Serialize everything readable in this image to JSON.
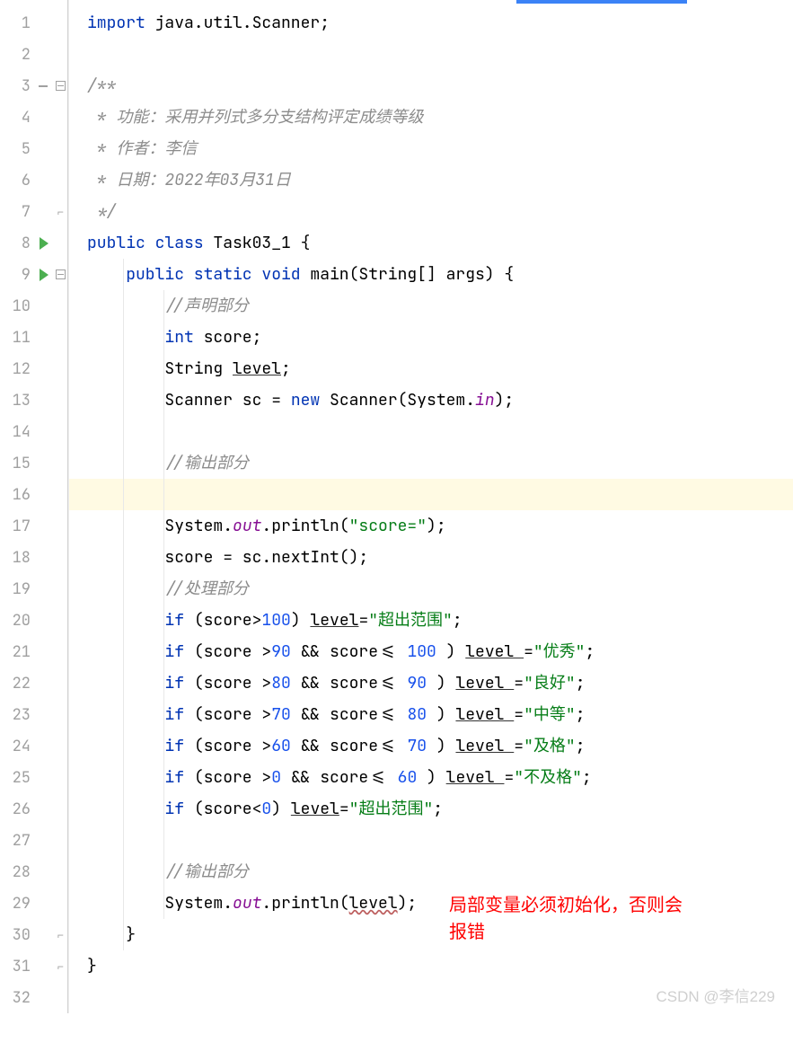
{
  "lines": [
    {
      "n": 1,
      "run": false,
      "fold": "",
      "indent": 0,
      "segments": [
        {
          "t": "import ",
          "c": "kw"
        },
        {
          "t": "java.util.Scanner;",
          "c": ""
        }
      ]
    },
    {
      "n": 2,
      "run": false,
      "fold": "",
      "indent": 0,
      "segments": []
    },
    {
      "n": 3,
      "run": false,
      "fold": "minus",
      "indent": 0,
      "segments": [
        {
          "t": "/**",
          "c": "comment"
        }
      ],
      "expand": true
    },
    {
      "n": 4,
      "run": false,
      "fold": "",
      "indent": 0,
      "segments": [
        {
          "t": " * 功能：采用并列式多分支结构评定成绩等级",
          "c": "comment"
        }
      ]
    },
    {
      "n": 5,
      "run": false,
      "fold": "",
      "indent": 0,
      "segments": [
        {
          "t": " * 作者：李信",
          "c": "comment"
        }
      ]
    },
    {
      "n": 6,
      "run": false,
      "fold": "",
      "indent": 0,
      "segments": [
        {
          "t": " * 日期：2022年03月31日",
          "c": "comment"
        }
      ]
    },
    {
      "n": 7,
      "run": false,
      "fold": "close",
      "indent": 0,
      "segments": [
        {
          "t": " */",
          "c": "comment"
        }
      ]
    },
    {
      "n": 8,
      "run": true,
      "fold": "",
      "indent": 0,
      "segments": [
        {
          "t": "public class ",
          "c": "kw"
        },
        {
          "t": "Task03_1 {",
          "c": ""
        }
      ]
    },
    {
      "n": 9,
      "run": true,
      "fold": "minus",
      "indent": 1,
      "segments": [
        {
          "t": "public static void ",
          "c": "kw"
        },
        {
          "t": "main",
          "c": ""
        },
        {
          "t": "(String[] args) {",
          "c": ""
        }
      ],
      "vline1": true
    },
    {
      "n": 10,
      "run": false,
      "fold": "",
      "indent": 2,
      "segments": [
        {
          "t": "//声明部分",
          "c": "comment"
        }
      ],
      "vline1": true,
      "vline2": true
    },
    {
      "n": 11,
      "run": false,
      "fold": "",
      "indent": 2,
      "segments": [
        {
          "t": "int ",
          "c": "kw"
        },
        {
          "t": "score;",
          "c": ""
        }
      ],
      "vline1": true,
      "vline2": true
    },
    {
      "n": 12,
      "run": false,
      "fold": "",
      "indent": 2,
      "segments": [
        {
          "t": "String ",
          "c": ""
        },
        {
          "t": "level",
          "c": "underline"
        },
        {
          "t": ";",
          "c": ""
        }
      ],
      "vline1": true,
      "vline2": true
    },
    {
      "n": 13,
      "run": false,
      "fold": "",
      "indent": 2,
      "segments": [
        {
          "t": "Scanner sc = ",
          "c": ""
        },
        {
          "t": "new ",
          "c": "kw"
        },
        {
          "t": "Scanner(System.",
          "c": ""
        },
        {
          "t": "in",
          "c": "field"
        },
        {
          "t": ");",
          "c": ""
        }
      ],
      "vline1": true,
      "vline2": true
    },
    {
      "n": 14,
      "run": false,
      "fold": "",
      "indent": 2,
      "segments": [],
      "vline1": true,
      "vline2": true
    },
    {
      "n": 15,
      "run": false,
      "fold": "",
      "indent": 2,
      "segments": [
        {
          "t": "//输出部分",
          "c": "comment"
        }
      ],
      "vline1": true,
      "vline2": true
    },
    {
      "n": 16,
      "run": false,
      "fold": "",
      "indent": 2,
      "segments": [],
      "highlight": true,
      "vline1": true,
      "vline2": true
    },
    {
      "n": 17,
      "run": false,
      "fold": "",
      "indent": 2,
      "segments": [
        {
          "t": "System.",
          "c": ""
        },
        {
          "t": "out",
          "c": "field"
        },
        {
          "t": ".println(",
          "c": ""
        },
        {
          "t": "\"score=\"",
          "c": "str"
        },
        {
          "t": ");",
          "c": ""
        }
      ],
      "vline1": true,
      "vline2": true
    },
    {
      "n": 18,
      "run": false,
      "fold": "",
      "indent": 2,
      "segments": [
        {
          "t": "score = sc.nextInt();",
          "c": ""
        }
      ],
      "vline1": true,
      "vline2": true
    },
    {
      "n": 19,
      "run": false,
      "fold": "",
      "indent": 2,
      "segments": [
        {
          "t": "//处理部分",
          "c": "comment"
        }
      ],
      "vline1": true,
      "vline2": true
    },
    {
      "n": 20,
      "run": false,
      "fold": "",
      "indent": 2,
      "segments": [
        {
          "t": "if ",
          "c": "kw"
        },
        {
          "t": "(score>",
          "c": ""
        },
        {
          "t": "100",
          "c": "num"
        },
        {
          "t": ") ",
          "c": ""
        },
        {
          "t": "level",
          "c": "underline"
        },
        {
          "t": "=",
          "c": ""
        },
        {
          "t": "\"超出范围\"",
          "c": "str"
        },
        {
          "t": ";",
          "c": ""
        }
      ],
      "vline1": true,
      "vline2": true
    },
    {
      "n": 21,
      "run": false,
      "fold": "",
      "indent": 2,
      "segments": [
        {
          "t": "if ",
          "c": "kw"
        },
        {
          "t": "(score >",
          "c": ""
        },
        {
          "t": "90 ",
          "c": "num"
        },
        {
          "t": "&& score<= ",
          "c": ""
        },
        {
          "t": "100 ",
          "c": "num"
        },
        {
          "t": ") ",
          "c": ""
        },
        {
          "t": "level ",
          "c": "underline"
        },
        {
          "t": "=",
          "c": ""
        },
        {
          "t": "\"优秀\"",
          "c": "str"
        },
        {
          "t": ";",
          "c": ""
        }
      ],
      "vline1": true,
      "vline2": true
    },
    {
      "n": 22,
      "run": false,
      "fold": "",
      "indent": 2,
      "segments": [
        {
          "t": "if ",
          "c": "kw"
        },
        {
          "t": "(score >",
          "c": ""
        },
        {
          "t": "80 ",
          "c": "num"
        },
        {
          "t": "&& score<= ",
          "c": ""
        },
        {
          "t": "90 ",
          "c": "num"
        },
        {
          "t": ") ",
          "c": ""
        },
        {
          "t": "level ",
          "c": "underline"
        },
        {
          "t": "=",
          "c": ""
        },
        {
          "t": "\"良好\"",
          "c": "str"
        },
        {
          "t": ";",
          "c": ""
        }
      ],
      "vline1": true,
      "vline2": true
    },
    {
      "n": 23,
      "run": false,
      "fold": "",
      "indent": 2,
      "segments": [
        {
          "t": "if ",
          "c": "kw"
        },
        {
          "t": "(score >",
          "c": ""
        },
        {
          "t": "70 ",
          "c": "num"
        },
        {
          "t": "&& score<= ",
          "c": ""
        },
        {
          "t": "80 ",
          "c": "num"
        },
        {
          "t": ") ",
          "c": ""
        },
        {
          "t": "level ",
          "c": "underline"
        },
        {
          "t": "=",
          "c": ""
        },
        {
          "t": "\"中等\"",
          "c": "str"
        },
        {
          "t": ";",
          "c": ""
        }
      ],
      "vline1": true,
      "vline2": true
    },
    {
      "n": 24,
      "run": false,
      "fold": "",
      "indent": 2,
      "segments": [
        {
          "t": "if ",
          "c": "kw"
        },
        {
          "t": "(score >",
          "c": ""
        },
        {
          "t": "60 ",
          "c": "num"
        },
        {
          "t": "&& score<= ",
          "c": ""
        },
        {
          "t": "70 ",
          "c": "num"
        },
        {
          "t": ") ",
          "c": ""
        },
        {
          "t": "level ",
          "c": "underline"
        },
        {
          "t": "=",
          "c": ""
        },
        {
          "t": "\"及格\"",
          "c": "str"
        },
        {
          "t": ";",
          "c": ""
        }
      ],
      "vline1": true,
      "vline2": true
    },
    {
      "n": 25,
      "run": false,
      "fold": "",
      "indent": 2,
      "segments": [
        {
          "t": "if ",
          "c": "kw"
        },
        {
          "t": "(score >",
          "c": ""
        },
        {
          "t": "0 ",
          "c": "num"
        },
        {
          "t": "&& score<= ",
          "c": ""
        },
        {
          "t": "60 ",
          "c": "num"
        },
        {
          "t": ") ",
          "c": ""
        },
        {
          "t": "level ",
          "c": "underline"
        },
        {
          "t": "=",
          "c": ""
        },
        {
          "t": "\"不及格\"",
          "c": "str"
        },
        {
          "t": ";",
          "c": ""
        }
      ],
      "vline1": true,
      "vline2": true
    },
    {
      "n": 26,
      "run": false,
      "fold": "",
      "indent": 2,
      "segments": [
        {
          "t": "if ",
          "c": "kw"
        },
        {
          "t": "(score<",
          "c": ""
        },
        {
          "t": "0",
          "c": "num"
        },
        {
          "t": ") ",
          "c": ""
        },
        {
          "t": "level",
          "c": "underline"
        },
        {
          "t": "=",
          "c": ""
        },
        {
          "t": "\"超出范围\"",
          "c": "str"
        },
        {
          "t": ";",
          "c": ""
        }
      ],
      "vline1": true,
      "vline2": true
    },
    {
      "n": 27,
      "run": false,
      "fold": "",
      "indent": 2,
      "segments": [],
      "vline1": true,
      "vline2": true
    },
    {
      "n": 28,
      "run": false,
      "fold": "",
      "indent": 2,
      "segments": [
        {
          "t": "//输出部分",
          "c": "comment"
        }
      ],
      "vline1": true,
      "vline2": true
    },
    {
      "n": 29,
      "run": false,
      "fold": "",
      "indent": 2,
      "segments": [
        {
          "t": "System.",
          "c": ""
        },
        {
          "t": "out",
          "c": "field"
        },
        {
          "t": ".println(",
          "c": ""
        },
        {
          "t": "level",
          "c": "err-underline"
        },
        {
          "t": ");",
          "c": ""
        }
      ],
      "vline1": true,
      "vline2": true
    },
    {
      "n": 30,
      "run": false,
      "fold": "close",
      "indent": 1,
      "segments": [
        {
          "t": "}",
          "c": ""
        }
      ],
      "vline1": true
    },
    {
      "n": 31,
      "run": false,
      "fold": "close",
      "indent": 0,
      "segments": [
        {
          "t": "}",
          "c": ""
        }
      ]
    },
    {
      "n": 32,
      "run": false,
      "fold": "",
      "indent": 0,
      "segments": []
    }
  ],
  "annotation": {
    "line1": "局部变量必须初始化，否则会",
    "line2": "报错"
  },
  "watermark": "CSDN @李信229"
}
